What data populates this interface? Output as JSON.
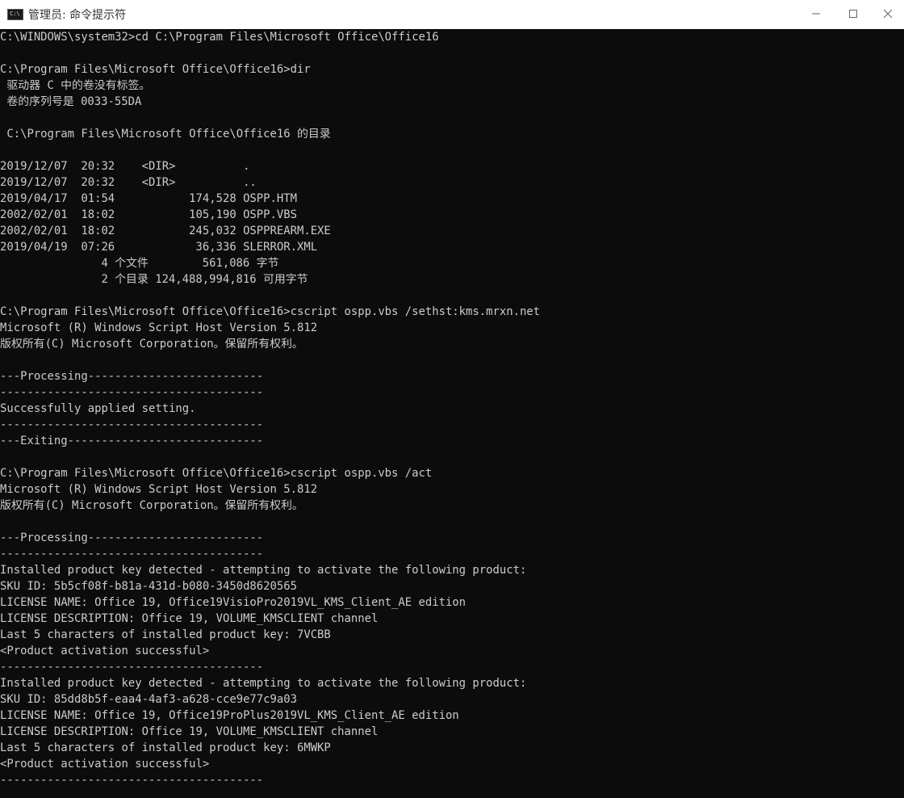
{
  "window": {
    "title": "管理员: 命令提示符"
  },
  "controls": {
    "minimize_icon": "minimize-icon",
    "maximize_icon": "maximize-icon",
    "close_icon": "close-icon"
  },
  "colors": {
    "console_background": "#0c0c0c",
    "console_text": "#cccccc",
    "titlebar_background": "#ffffff"
  },
  "console": {
    "lines": [
      "C:\\WINDOWS\\system32>cd C:\\Program Files\\Microsoft Office\\Office16",
      "",
      "C:\\Program Files\\Microsoft Office\\Office16>dir",
      " 驱动器 C 中的卷没有标签。",
      " 卷的序列号是 0033-55DA",
      "",
      " C:\\Program Files\\Microsoft Office\\Office16 的目录",
      "",
      "2019/12/07  20:32    <DIR>          .",
      "2019/12/07  20:32    <DIR>          ..",
      "2019/04/17  01:54           174,528 OSPP.HTM",
      "2002/02/01  18:02           105,190 OSPP.VBS",
      "2002/02/01  18:02           245,032 OSPPREARM.EXE",
      "2019/04/19  07:26            36,336 SLERROR.XML",
      "               4 个文件        561,086 字节",
      "               2 个目录 124,488,994,816 可用字节",
      "",
      "C:\\Program Files\\Microsoft Office\\Office16>cscript ospp.vbs /sethst:kms.mrxn.net",
      "Microsoft (R) Windows Script Host Version 5.812",
      "版权所有(C) Microsoft Corporation。保留所有权利。",
      "",
      "---Processing--------------------------",
      "---------------------------------------",
      "Successfully applied setting.",
      "---------------------------------------",
      "---Exiting-----------------------------",
      "",
      "C:\\Program Files\\Microsoft Office\\Office16>cscript ospp.vbs /act",
      "Microsoft (R) Windows Script Host Version 5.812",
      "版权所有(C) Microsoft Corporation。保留所有权利。",
      "",
      "---Processing--------------------------",
      "---------------------------------------",
      "Installed product key detected - attempting to activate the following product:",
      "SKU ID: 5b5cf08f-b81a-431d-b080-3450d8620565",
      "LICENSE NAME: Office 19, Office19VisioPro2019VL_KMS_Client_AE edition",
      "LICENSE DESCRIPTION: Office 19, VOLUME_KMSCLIENT channel",
      "Last 5 characters of installed product key: 7VCBB",
      "<Product activation successful>",
      "---------------------------------------",
      "Installed product key detected - attempting to activate the following product:",
      "SKU ID: 85dd8b5f-eaa4-4af3-a628-cce9e77c9a03",
      "LICENSE NAME: Office 19, Office19ProPlus2019VL_KMS_Client_AE edition",
      "LICENSE DESCRIPTION: Office 19, VOLUME_KMSCLIENT channel",
      "Last 5 characters of installed product key: 6MWKP",
      "<Product activation successful>",
      "---------------------------------------"
    ]
  }
}
